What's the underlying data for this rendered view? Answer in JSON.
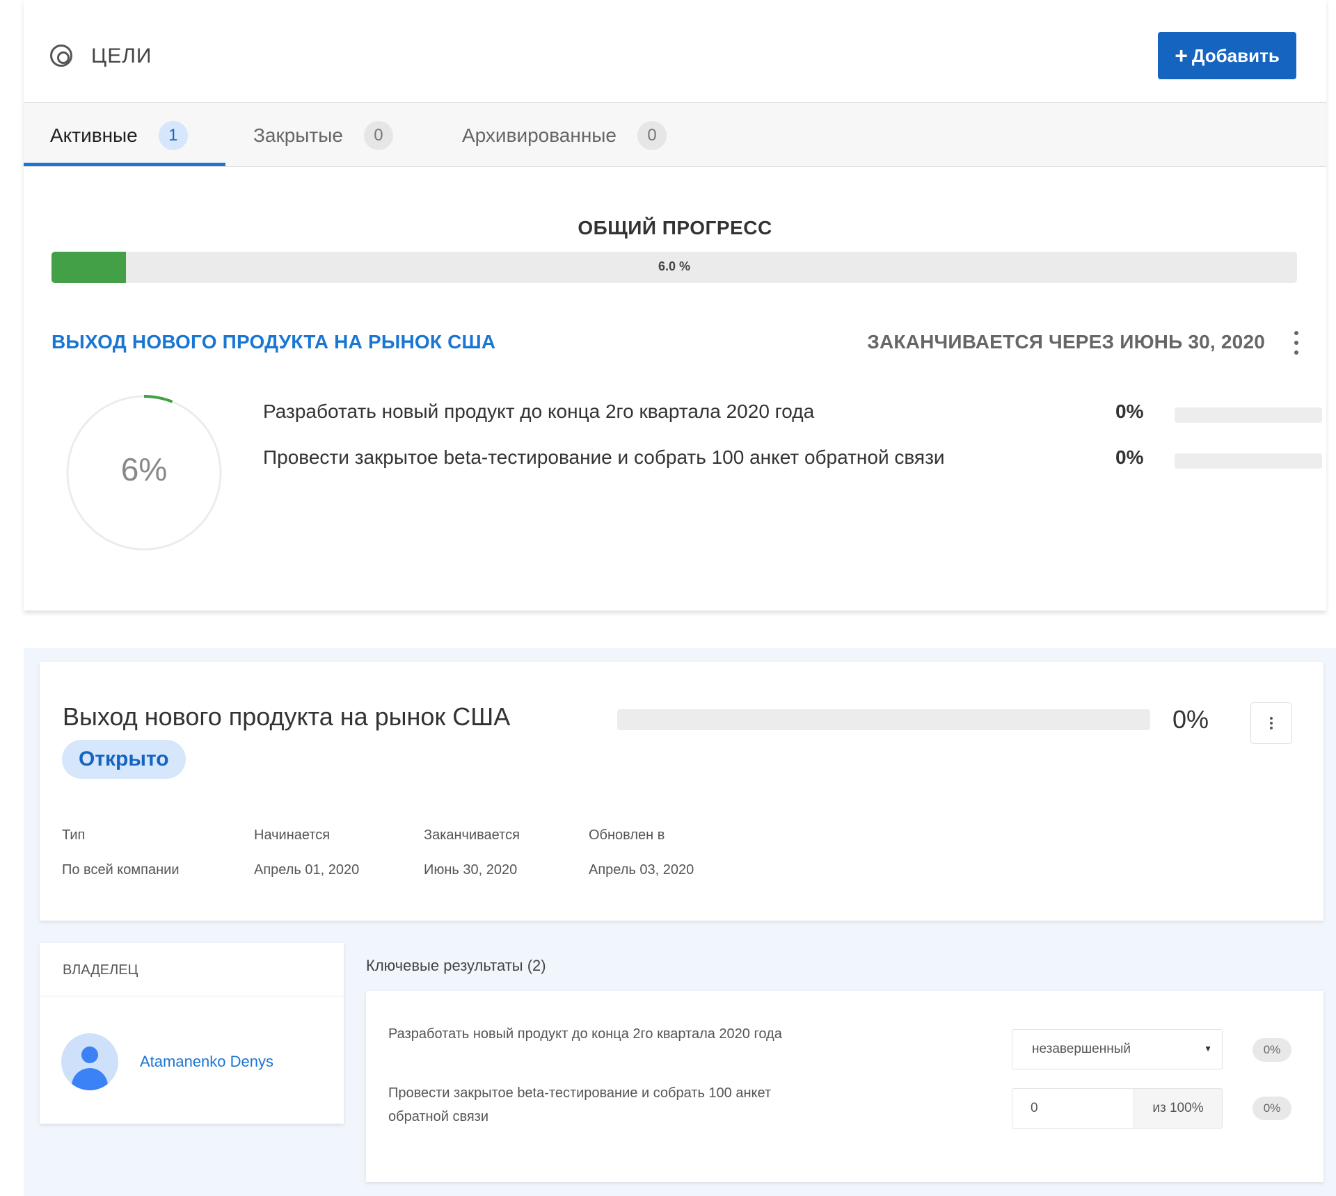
{
  "header": {
    "title": "ЦЕЛИ",
    "add_button": "Добавить",
    "add_icon": "+"
  },
  "tabs": [
    {
      "label": "Активные",
      "count": "1",
      "active": true
    },
    {
      "label": "Закрытые",
      "count": "0",
      "active": false
    },
    {
      "label": "Архивированные",
      "count": "0",
      "active": false
    }
  ],
  "overall": {
    "title": "ОБЩИЙ ПРОГРЕСС",
    "progress_text": "6.0 %",
    "progress_percent": 6
  },
  "goal_summary": {
    "title": "ВЫХОД НОВОГО ПРОДУКТА НА РЫНОК США",
    "ends": "ЗАКАНЧИВАЕТСЯ ЧЕРЕЗ ИЮНЬ 30, 2020",
    "ring_text": "6%",
    "ring_percent": 6,
    "key_results": [
      {
        "name": "Разработать новый продукт до конца 2го квартала 2020 года",
        "pct": "0%",
        "value": 0
      },
      {
        "name": "Провести закрытое beta-тестирование и собрать 100 анкет обратной связи",
        "pct": "0%",
        "value": 0
      }
    ]
  },
  "detail": {
    "title": "Выход нового продукта на рынок США",
    "pct": "0%",
    "progress_percent": 0,
    "status": "Открыто",
    "meta": {
      "type_label": "Тип",
      "type_value": "По всей компании",
      "starts_label": "Начинается",
      "starts_value": "Апрель 01, 2020",
      "ends_label": "Заканчивается",
      "ends_value": "Июнь 30, 2020",
      "updated_label": "Обновлен в",
      "updated_value": "Апрель 03, 2020"
    }
  },
  "owner": {
    "label": "ВЛАДЕЛЕЦ",
    "name": "Atamanenko Denys"
  },
  "kr_section": {
    "title": "Ключевые результаты (2)",
    "items": [
      {
        "name": "Разработать новый продукт до конца 2го квартала 2020 года",
        "select_value": "незавершенный",
        "badge": "0%"
      },
      {
        "name": "Провести закрытое beta-тестирование и собрать 100 анкет обратной связи",
        "input_value": "0",
        "suffix": "из 100%",
        "badge": "0%"
      }
    ]
  },
  "colors": {
    "accent": "#1976d2",
    "button": "#1565c0",
    "progress": "#43a047",
    "pill_bg": "#d6e6fb",
    "lower_bg": "#f1f5fc"
  }
}
